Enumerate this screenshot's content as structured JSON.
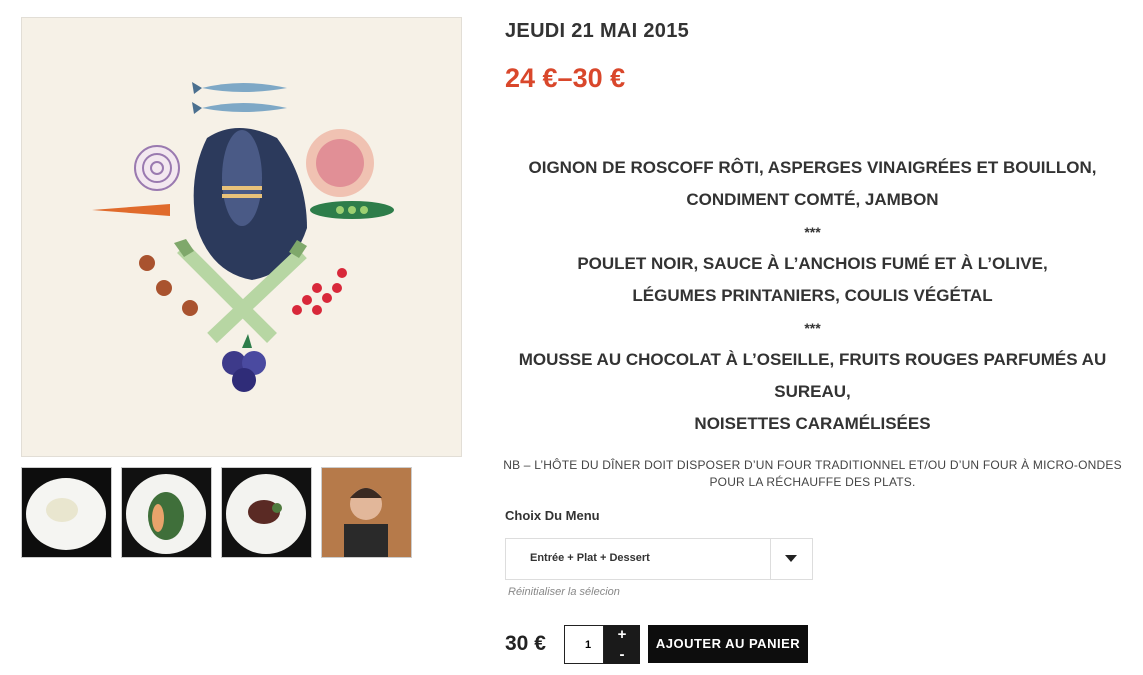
{
  "product": {
    "date": "JEUDI 21 MAI 2015",
    "price_range": "24 €–30 €",
    "menu": {
      "line1": "OIGNON DE ROSCOFF RÔTI, ASPERGES VINAIGRÉES ET BOUILLON,",
      "line2": "CONDIMENT COMTÉ, JAMBON",
      "sep1": "***",
      "line3": "POULET NOIR, SAUCE À L’ANCHOIS FUMÉ ET À L’OLIVE,",
      "line4": "LÉGUMES PRINTANIERS, COULIS VÉGÉTAL",
      "sep2": "***",
      "line5": "MOUSSE AU CHOCOLAT À L’OSEILLE, FRUITS ROUGES PARFUMÉS AU SUREAU,",
      "line6": "NOISETTES CARAMÉLISÉES"
    },
    "note_line1": "NB – L’HÔTE DU DÎNER DOIT DISPOSER D’UN FOUR TRADITIONNEL ET/OU D’UN FOUR À MICRO-ONDES",
    "note_line2": "POUR LA RÉCHAUFFE DES PLATS.",
    "choice_label": "Choix Du Menu",
    "choice_selected": "Entrée + Plat + Dessert",
    "reset_label": "Réinitialiser la sélecion",
    "final_price": "30 €",
    "quantity": "1",
    "plus_label": "+",
    "minus_label": "-",
    "add_to_cart_label": "AJOUTER AU PANIER"
  },
  "colors": {
    "accent": "#d9472b",
    "button": "#0d0d0d",
    "image_bg": "#f6f1e7"
  },
  "icons": {
    "dropdown": "caret-down-icon"
  }
}
